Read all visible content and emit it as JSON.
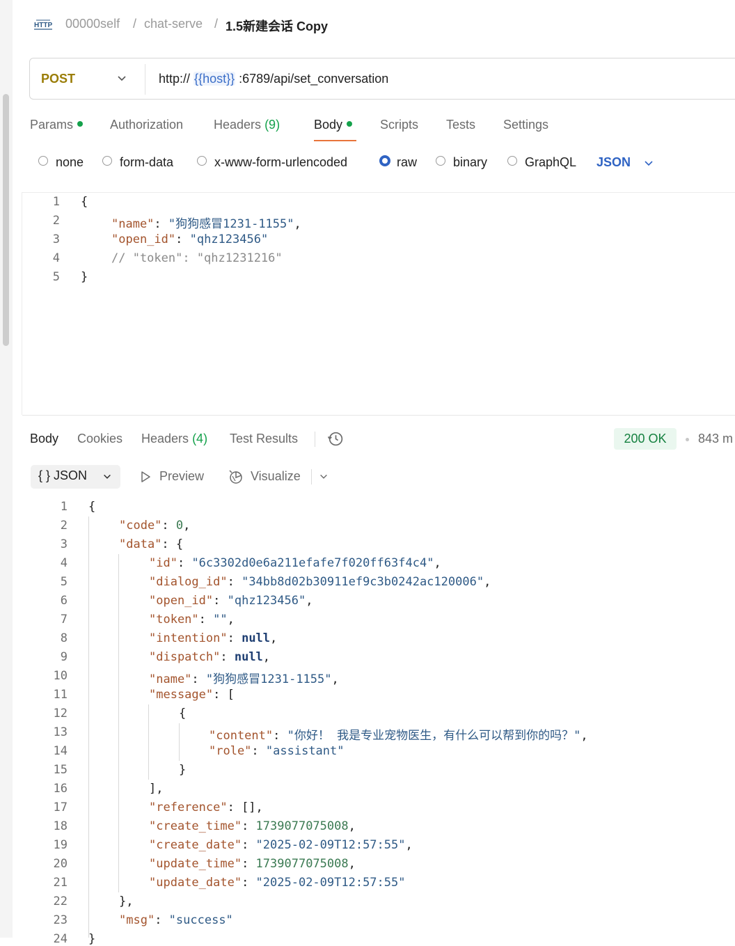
{
  "breadcrumb": {
    "workspace": "00000self",
    "collection": "chat-serve",
    "request": "1.5新建会话 Copy"
  },
  "request": {
    "method": "POST",
    "url_prefix": "http://",
    "url_var": "{{host}}",
    "url_suffix": ":6789/api/set_conversation"
  },
  "tabs": {
    "params": "Params",
    "authorization": "Authorization",
    "headers": "Headers",
    "headers_count": "(9)",
    "body": "Body",
    "scripts": "Scripts",
    "tests": "Tests",
    "settings": "Settings"
  },
  "body_types": {
    "none": "none",
    "form_data": "form-data",
    "urlencoded": "x-www-form-urlencoded",
    "raw": "raw",
    "binary": "binary",
    "graphql": "GraphQL",
    "language": "JSON",
    "selected": "raw"
  },
  "request_body": {
    "line_numbers": [
      "1",
      "2",
      "3",
      "4",
      "5"
    ],
    "name_key": "\"name\"",
    "name_val": "\"狗狗感冒1231-1155\"",
    "open_id_key": "\"open_id\"",
    "open_id_val": "\"qhz123456\"",
    "comment": "// \"token\": \"qhz1231216\""
  },
  "response": {
    "tabs": {
      "body": "Body",
      "cookies": "Cookies",
      "headers": "Headers",
      "headers_count": "(4)",
      "test_results": "Test Results"
    },
    "status": "200 OK",
    "time": "843 m",
    "format": "JSON",
    "preview": "Preview",
    "visualize": "Visualize",
    "line_numbers": [
      "1",
      "2",
      "3",
      "4",
      "5",
      "6",
      "7",
      "8",
      "9",
      "10",
      "11",
      "12",
      "13",
      "14",
      "15",
      "16",
      "17",
      "18",
      "19",
      "20",
      "21",
      "22",
      "23",
      "24"
    ],
    "code_val": "0",
    "id_val": "\"6c3302d0e6a211efafe7f020ff63f4c4\"",
    "dialog_id_val": "\"34bb8d02b30911ef9c3b0242ac120006\"",
    "open_id_val": "\"qhz123456\"",
    "token_val": "\"\"",
    "null_val": "null",
    "name_val": "\"狗狗感冒1231-1155\"",
    "content_val": "\"你好！ 我是专业宠物医生，有什么可以帮到你的吗？\"",
    "role_val": "\"assistant\"",
    "create_time_val": "1739077075008",
    "create_date_val": "\"2025-02-09T12:57:55\"",
    "update_time_val": "1739077075008",
    "update_date_val": "\"2025-02-09T12:57:55\"",
    "msg_val": "\"success\""
  },
  "colors": {
    "method": "#9a7d08",
    "accent_orange": "#e8743b",
    "success_green": "#14a14b",
    "link_blue": "#2f63c3"
  },
  "icons": [
    "http-icon",
    "chevron-down-icon",
    "history-icon",
    "braces-icon",
    "play-icon",
    "visualize-icon"
  ]
}
